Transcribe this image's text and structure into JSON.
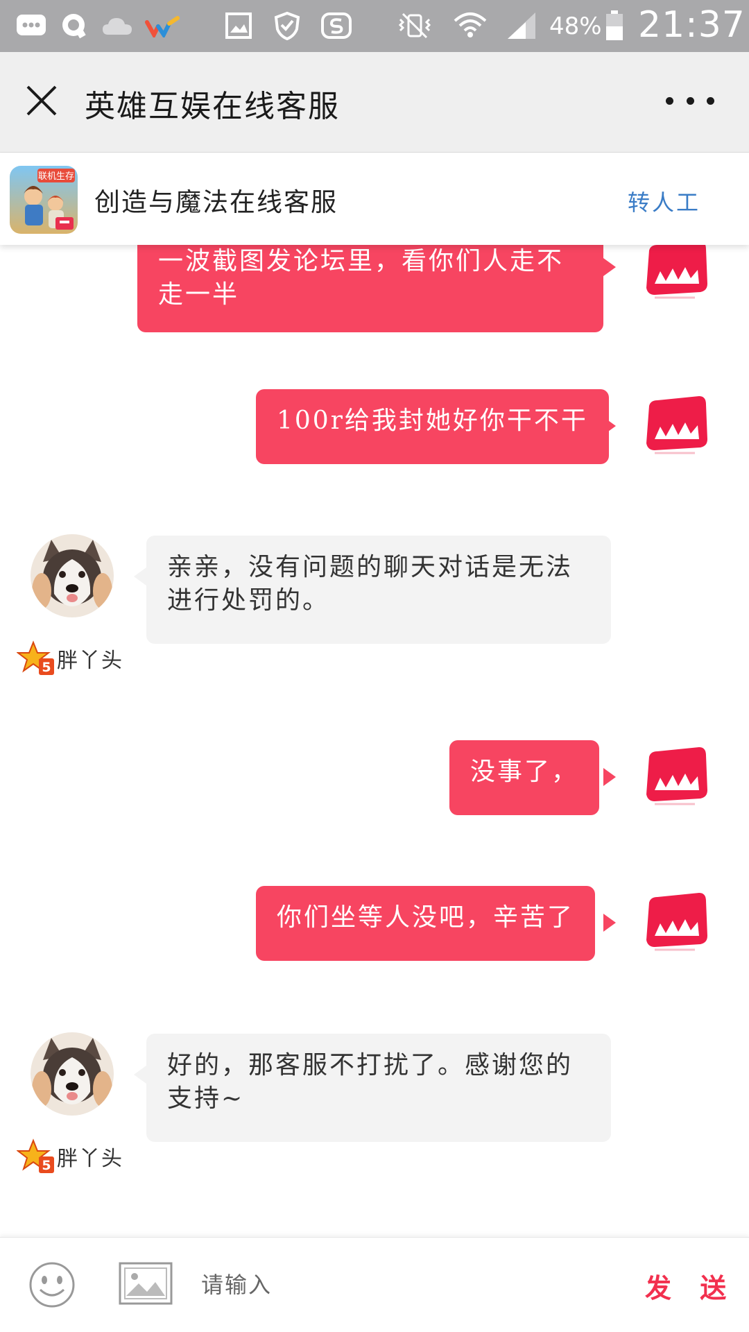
{
  "status_bar": {
    "battery_percent": "48%",
    "time": "21:37",
    "icons": [
      "message-icon",
      "qq-icon",
      "cloud-icon",
      "app-logo-icon",
      "gallery-icon",
      "shield-icon",
      "sogou-icon",
      "vibrate-mute-icon",
      "wifi-icon",
      "signal-icon",
      "battery-icon"
    ]
  },
  "title_bar": {
    "title": "英雄互娱在线客服",
    "close_icon": "close-icon",
    "more_icon": "more-icon"
  },
  "service_header": {
    "name": "创造与魔法在线客服",
    "transfer_label": "转人工",
    "game_icon_text": "联机生存",
    "colors": {
      "transfer": "#3a7cc6"
    }
  },
  "messages": [
    {
      "from": "user",
      "text": "一波截图发论坛里，看你们人走不走一半"
    },
    {
      "from": "user",
      "text": "100r给我封她好你干不干"
    },
    {
      "from": "agent",
      "text": "亲亲，没有问题的聊天对话是无法进行处罚的。",
      "agent_name": "胖丫头",
      "badge": "5"
    },
    {
      "from": "user",
      "text": "没事了，"
    },
    {
      "from": "user",
      "text": "你们坐等人没吧，辛苦了"
    },
    {
      "from": "agent",
      "text": "好的，那客服不打扰了。感谢您的支持~",
      "agent_name": "胖丫头",
      "badge": "5"
    }
  ],
  "input_bar": {
    "placeholder": "请输入",
    "send_label": "发 送",
    "emoji_icon": "emoji-icon",
    "image_icon": "image-icon"
  },
  "colors": {
    "user_bubble": "#f74561",
    "agent_bubble": "#f3f3f3",
    "status_bar": "#a9a9ab",
    "title_bar": "#efefef",
    "send": "#f2304e"
  }
}
